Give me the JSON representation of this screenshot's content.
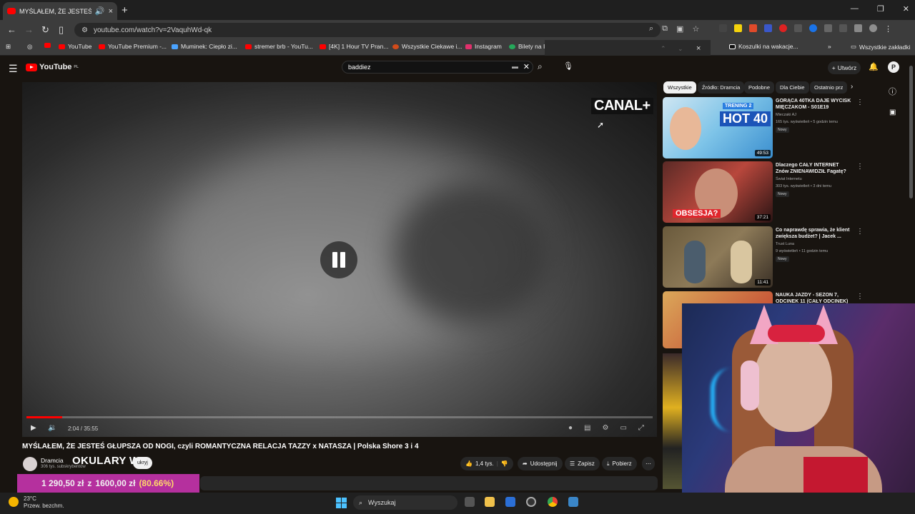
{
  "browser": {
    "tab_title": "MYŚLAŁEM, ŻE JESTEŚ GŁUPSZA",
    "tab_audio_icon": "speaker-icon",
    "tab_close": "×",
    "new_tab": "+",
    "url": "youtube.com/watch?v=2VaquhWd-qk",
    "bookmarks": [
      "YouTube",
      "YouTube Premium -...",
      "Muminek: Ciepło zi...",
      "stremer brb - YouTu...",
      "[4K] 1 Hour TV Pran...",
      "Wszystkie Ciekawe i...",
      "Instagram",
      "Bilety na I",
      "Koszulki na wakacje...",
      "Wszystkie zakładki"
    ],
    "findbar_close": "×"
  },
  "youtube": {
    "logo": "YouTube",
    "logo_region": "PL",
    "search_query": "baddiez",
    "create_label": "Utwórz",
    "avatar_letter": "P"
  },
  "video": {
    "watermark": "CANAL+",
    "time": "2:04 / 35:55",
    "progress": 0.0575,
    "title": "MYŚLAŁEM, ŻE JESTEŚ GŁUPSZA OD NOGI, czyli ROMANTYCZNA RELACJA TAZZY x NATASZA | Polska Shore 3 i 4",
    "channel": "Dramcia",
    "subscribers": "306 tys. subskrybentów",
    "overlay_text": "OKULARY W",
    "hide_label": "ukryj",
    "likes": "1,4 tys.",
    "share": "Udostępnij",
    "save": "Zapisz",
    "download": "Pobierz"
  },
  "donation": {
    "amount": "1 290,50 zł",
    "of": "z",
    "goal": "1600,00 zł",
    "percent": "(80.66%)"
  },
  "chips": [
    "Wszystkie",
    "Źródło: Dramcia",
    "Podobne",
    "Dla Ciebie",
    "Ostatnio prz"
  ],
  "recommendations": [
    {
      "title": "GORĄCA 40TKA DAJE WYCISK MIĘCZAKOM - S01E19",
      "channel": "Mieczaki AJ",
      "meta": "165 tys. wyświetleń • 5 godzin temu",
      "badge": "Nowy",
      "duration": "49:53",
      "thumb_text": "HOT 40",
      "thumb_text2": "TRENING 2"
    },
    {
      "title": "Dlaczego CAŁY INTERNET Znów ZNIENAWIDZIŁ Fagatę?",
      "channel": "Świat Internetu",
      "meta": "303 tys. wyświetleń • 3 dni temu",
      "badge": "Nowy",
      "duration": "37:21",
      "thumb_text": "OBSESJA?"
    },
    {
      "title": "Co naprawdę sprawia, że klient zwiększa budżet? | Jacek ...",
      "channel": "Trust Luna",
      "meta": "9 wyświetleń • 11 godzin temu",
      "badge": "Nowy",
      "duration": "11:41"
    },
    {
      "title": "NAUKA JAZDY - SEZON 7, ODCINEK 11 (CAŁY ODCINEK)",
      "channel": "",
      "meta": "",
      "badge": "",
      "duration": ""
    }
  ],
  "taskbar": {
    "temp": "23°C",
    "weather": "Przew. bezchm.",
    "search": "Wyszukaj"
  },
  "colors": {
    "accent": "#ff0000",
    "donation_bg": "#b5309e",
    "donation_pct": "#ffd96a"
  }
}
